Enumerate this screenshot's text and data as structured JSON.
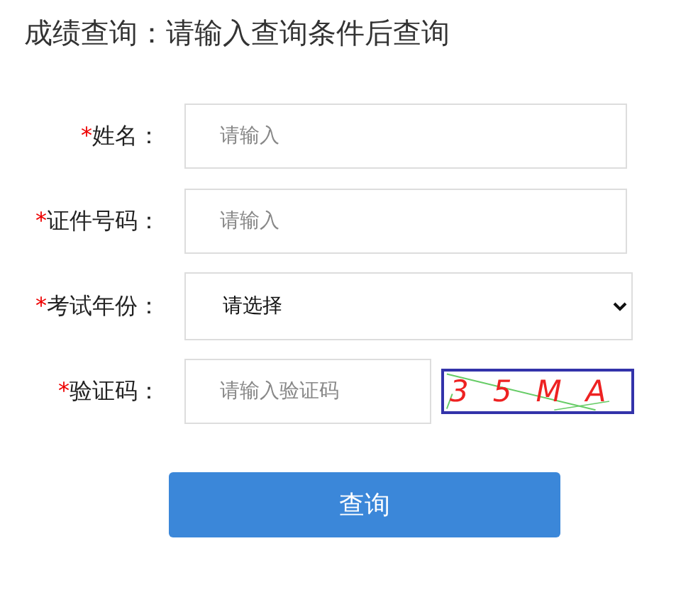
{
  "title": "成绩查询：请输入查询条件后查询",
  "fields": [
    {
      "kind": "text",
      "required_mark": "*",
      "label": "姓名：",
      "placeholder": "请输入"
    },
    {
      "kind": "text",
      "required_mark": "*",
      "label": "证件号码：",
      "placeholder": "请输入"
    },
    {
      "kind": "select",
      "required_mark": "*",
      "label": "考试年份：",
      "value": "请选择"
    },
    {
      "kind": "captcha",
      "required_mark": "*",
      "label": "验证码：",
      "placeholder": "请输入验证码",
      "captcha_text": "35MA"
    }
  ],
  "submit_button": "查询"
}
